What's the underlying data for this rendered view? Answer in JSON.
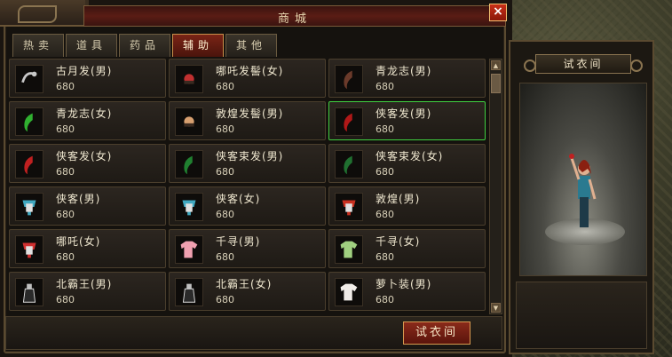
{
  "window": {
    "title": "商城",
    "close_label": "×"
  },
  "tabs": [
    {
      "label": "热卖",
      "active": false
    },
    {
      "label": "道具",
      "active": false
    },
    {
      "label": "药品",
      "active": false
    },
    {
      "label": "辅助",
      "active": true
    },
    {
      "label": "其他",
      "active": false
    }
  ],
  "items": [
    {
      "name": "古月发(男)",
      "price": "680",
      "icon": "hair-accessory-icon",
      "color": "#c8c8c8"
    },
    {
      "name": "哪吒发髻(女)",
      "price": "680",
      "icon": "hairpin-icon",
      "color": "#c03030"
    },
    {
      "name": "青龙志(男)",
      "price": "680",
      "icon": "hair-icon",
      "color": "#6a3a2a"
    },
    {
      "name": "青龙志(女)",
      "price": "680",
      "icon": "hair-icon",
      "color": "#30b030"
    },
    {
      "name": "敦煌发髻(男)",
      "price": "680",
      "icon": "hairpin-icon",
      "color": "#d8a070"
    },
    {
      "name": "侠客发(男)",
      "price": "680",
      "icon": "hair-icon",
      "color": "#b01818",
      "selected": true
    },
    {
      "name": "侠客发(女)",
      "price": "680",
      "icon": "hair-icon",
      "color": "#c02020"
    },
    {
      "name": "侠客束发(男)",
      "price": "680",
      "icon": "hair-icon",
      "color": "#208030"
    },
    {
      "name": "侠客束发(女)",
      "price": "680",
      "icon": "hair-icon",
      "color": "#207030"
    },
    {
      "name": "侠客(男)",
      "price": "680",
      "icon": "armor-icon",
      "color": "#40a8c0"
    },
    {
      "name": "侠客(女)",
      "price": "680",
      "icon": "armor-icon",
      "color": "#40a8c0"
    },
    {
      "name": "敦煌(男)",
      "price": "680",
      "icon": "armor-icon",
      "color": "#c83020"
    },
    {
      "name": "哪吒(女)",
      "price": "680",
      "icon": "armor-icon",
      "color": "#d03030"
    },
    {
      "name": "千寻(男)",
      "price": "680",
      "icon": "shirt-icon",
      "color": "#f0a0b0"
    },
    {
      "name": "千寻(女)",
      "price": "680",
      "icon": "shirt-icon",
      "color": "#a0d080"
    },
    {
      "name": "北霸王(男)",
      "price": "680",
      "icon": "robe-icon",
      "color": "#e0e0e0"
    },
    {
      "name": "北霸王(女)",
      "price": "680",
      "icon": "robe-icon",
      "color": "#e0e0e0"
    },
    {
      "name": "萝卜装(男)",
      "price": "680",
      "icon": "shirt-icon",
      "color": "#f0ece8"
    }
  ],
  "footer": {
    "try_on_button": "试衣间"
  },
  "fitting_room": {
    "title": "试衣间"
  },
  "colors": {
    "accent": "#7a2416",
    "selected_border": "#40d040",
    "panel": "#15120e"
  }
}
